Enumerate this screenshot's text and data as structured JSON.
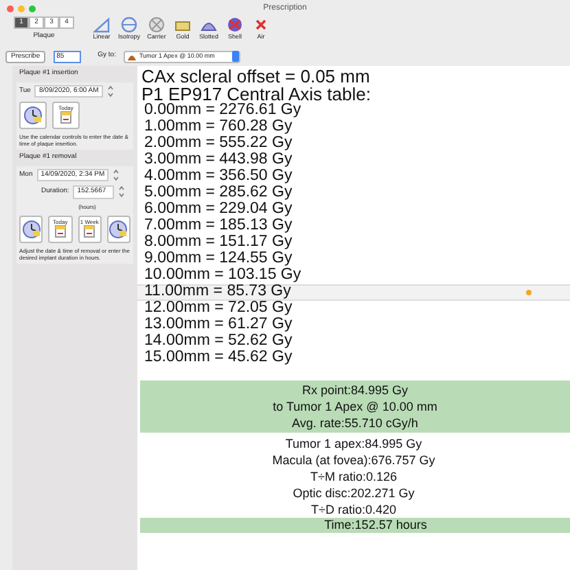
{
  "window": {
    "title": "Prescription"
  },
  "plaque_tabs": [
    {
      "label": "1",
      "selected": true
    },
    {
      "label": "2",
      "selected": false
    },
    {
      "label": "3",
      "selected": false
    },
    {
      "label": "4",
      "selected": false
    }
  ],
  "plaque_label": "Plaque",
  "tools": [
    {
      "label": "Linear",
      "kind": "linear"
    },
    {
      "label": "Isotropy",
      "kind": "isotropy"
    },
    {
      "label": "Carrier",
      "kind": "carrier"
    },
    {
      "label": "Gold",
      "kind": "gold"
    },
    {
      "label": "Slotted",
      "kind": "slotted"
    },
    {
      "label": "Shell",
      "kind": "shell"
    },
    {
      "label": "Air",
      "kind": "air"
    }
  ],
  "prescribe": {
    "button": "Prescribe",
    "value": "85",
    "gy_to": "Gy to:",
    "target": "Tumor 1 Apex @ 10.00 mm"
  },
  "insertion": {
    "title": "Plaque #1 insertion",
    "day": "Tue",
    "datetime": "8/09/2020,  6:00 AM",
    "buttons": [
      {
        "kind": "clock"
      },
      {
        "kind": "calendar",
        "label": "Today"
      }
    ],
    "hint": "Use the calendar controls to enter the date & time of plaque insertion."
  },
  "removal": {
    "title": "Plaque #1 removal",
    "day": "Mon",
    "datetime": "14/09/2020,  2:34 PM",
    "duration_label": "Duration:",
    "duration": "152.5667",
    "unit": "(hours)",
    "buttons": [
      {
        "kind": "clock"
      },
      {
        "kind": "calendar",
        "label": "Today"
      },
      {
        "kind": "calendar",
        "label": "1 Week"
      },
      {
        "kind": "clock"
      }
    ],
    "hint": "Adjust the date & time of removal or enter the desired implant duration in hours."
  },
  "header": [
    "CAx scleral offset = 0.05 mm",
    "P1 EP917 Central Axis table:"
  ],
  "doses": [
    {
      "text": "0.00mm = 2276.61  Gy",
      "selected": false
    },
    {
      "text": "1.00mm = 760.28  Gy",
      "selected": false
    },
    {
      "text": "2.00mm = 555.22  Gy",
      "selected": false
    },
    {
      "text": "3.00mm = 443.98  Gy",
      "selected": false
    },
    {
      "text": "4.00mm = 356.50  Gy",
      "selected": false
    },
    {
      "text": "5.00mm = 285.62  Gy",
      "selected": false
    },
    {
      "text": "6.00mm = 229.04  Gy",
      "selected": false
    },
    {
      "text": "7.00mm = 185.13  Gy",
      "selected": false
    },
    {
      "text": "8.00mm = 151.17  Gy",
      "selected": false
    },
    {
      "text": "9.00mm = 124.55  Gy",
      "selected": false
    },
    {
      "text": "10.00mm = 103.15  Gy",
      "selected": false
    },
    {
      "text": "11.00mm = 85.73  Gy",
      "selected": true
    },
    {
      "text": "12.00mm = 72.05  Gy",
      "selected": false
    },
    {
      "text": "13.00mm = 61.27  Gy",
      "selected": false
    },
    {
      "text": "14.00mm = 52.62  Gy",
      "selected": false
    },
    {
      "text": "15.00mm = 45.62  Gy",
      "selected": false
    }
  ],
  "rx": [
    "Rx point:84.995 Gy",
    "to Tumor 1 Apex @ 10.00 mm",
    "Avg. rate:55.710 cGy/h"
  ],
  "results": [
    "Tumor 1 apex:84.995 Gy",
    "Macula (at fovea):676.757 Gy",
    "T÷M ratio:0.126",
    "Optic disc:202.271 Gy",
    "T÷D ratio:0.420"
  ],
  "time": "Time:152.57 hours"
}
